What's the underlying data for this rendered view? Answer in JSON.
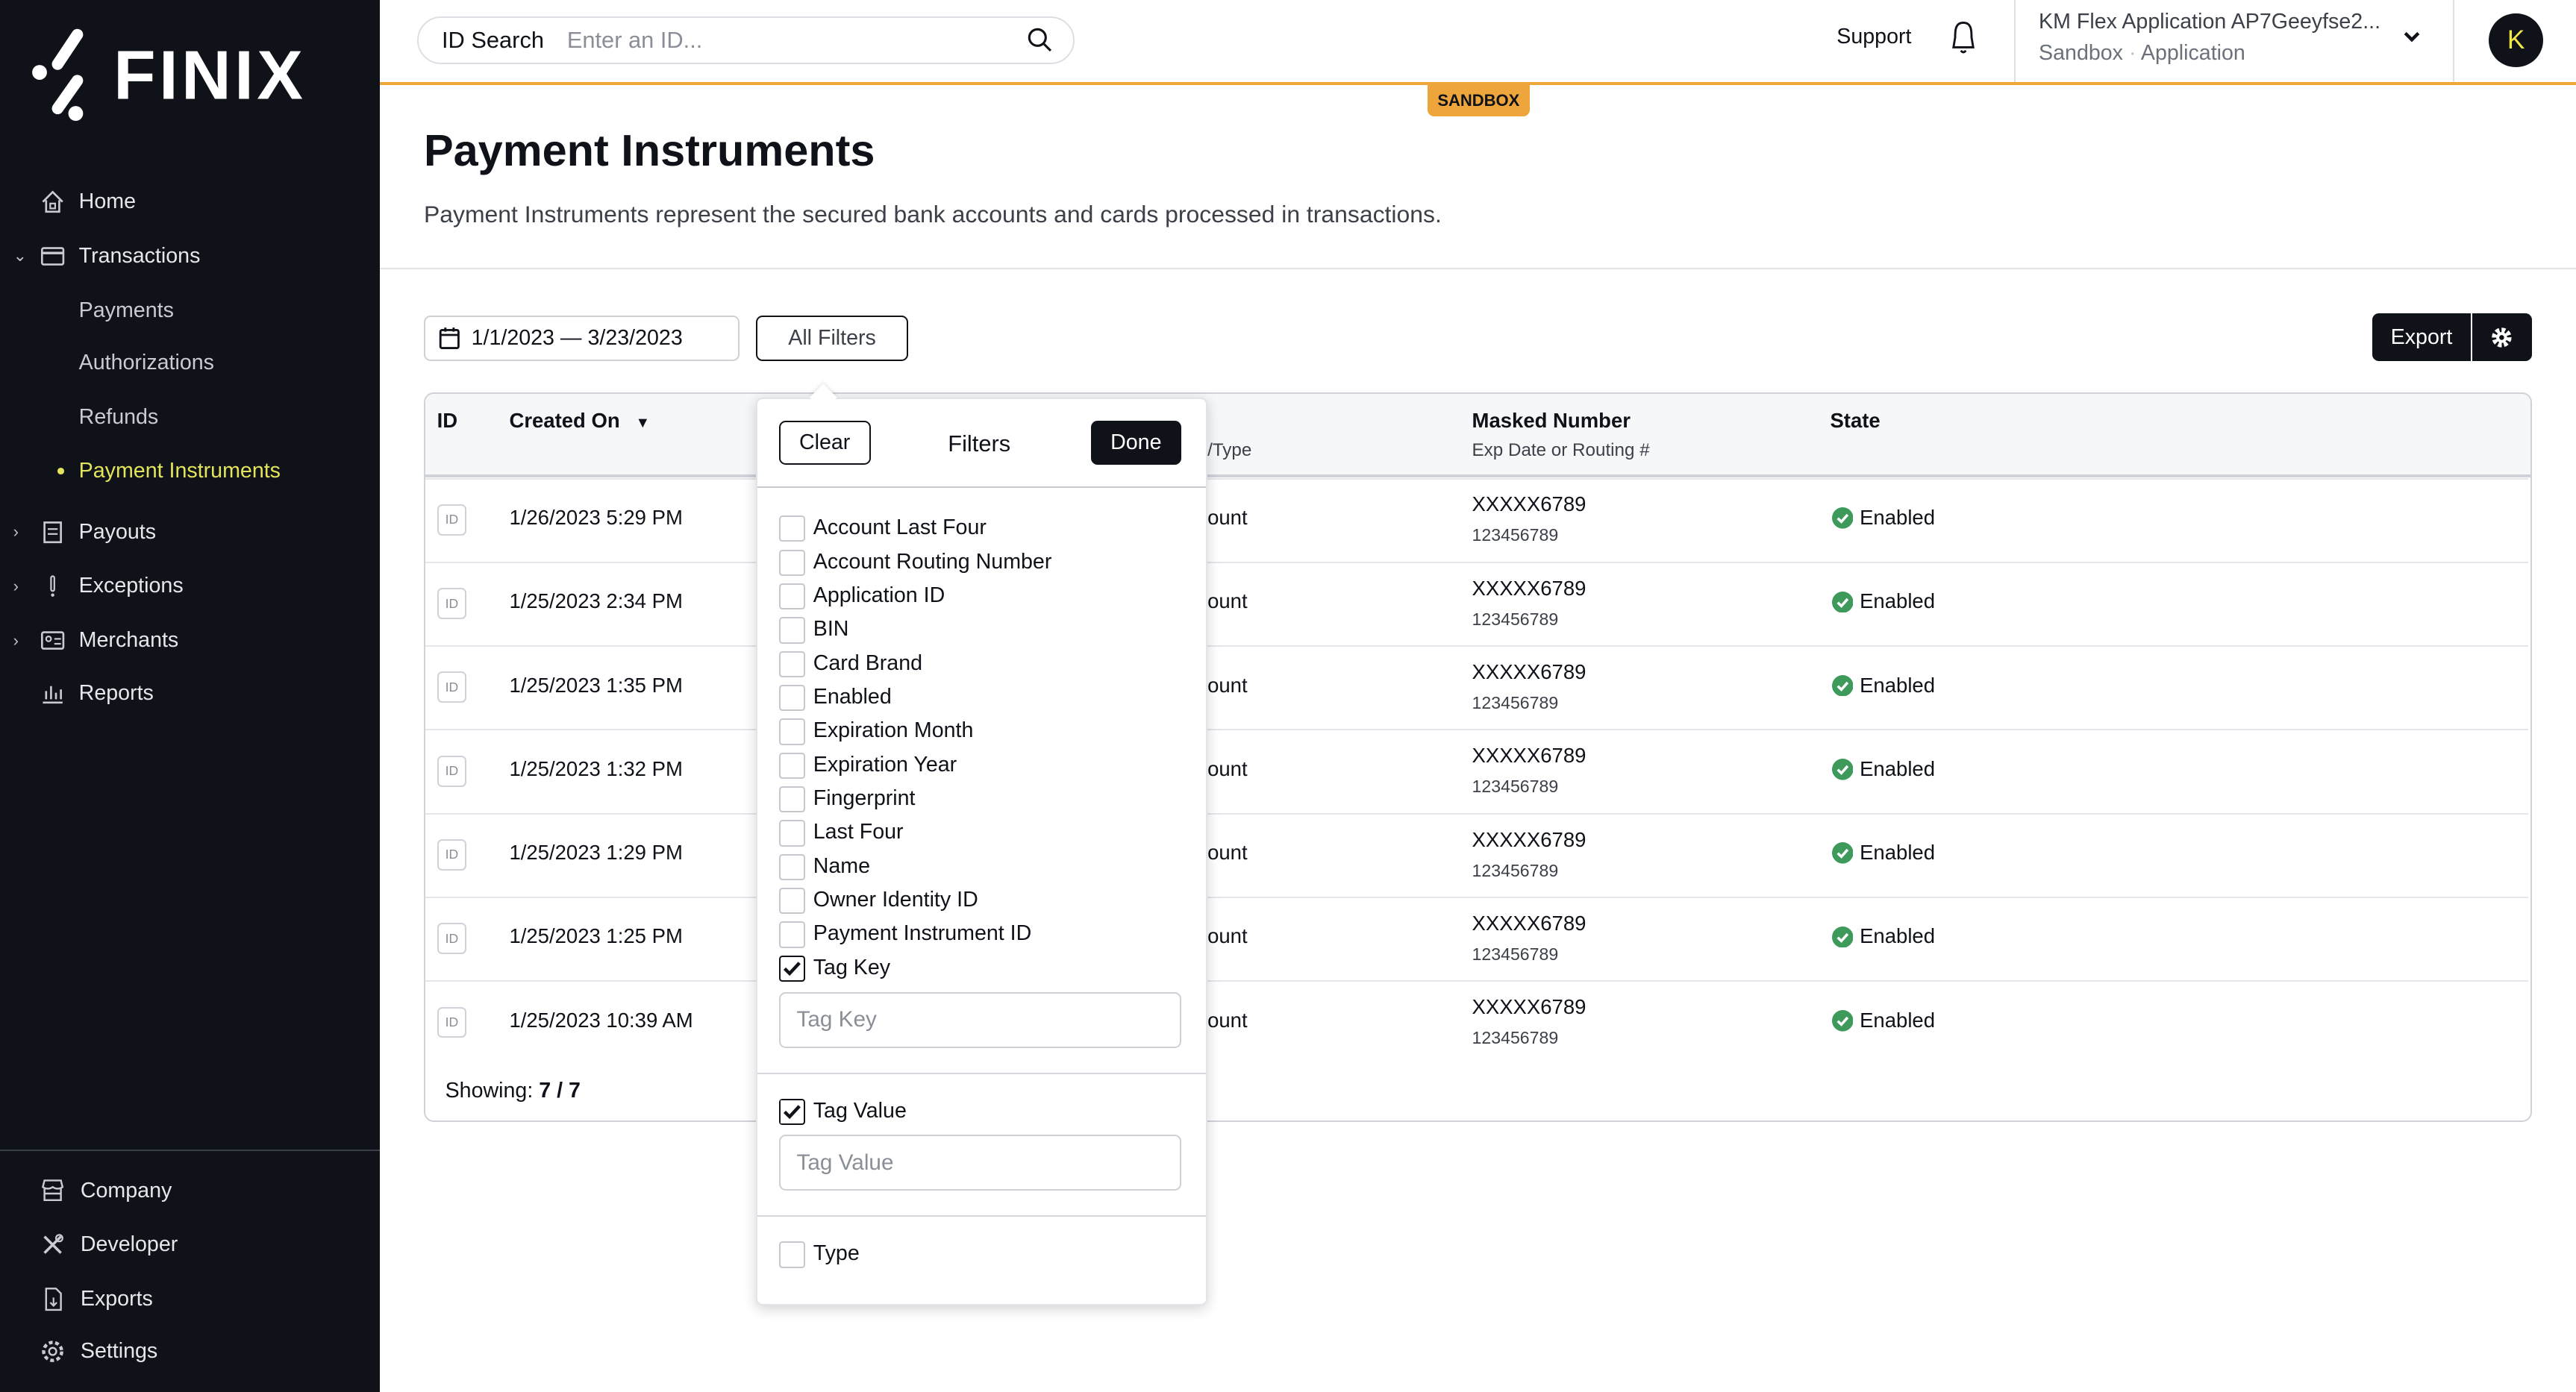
{
  "brand": {
    "logo_text": "FINIX"
  },
  "sidebar": {
    "items": [
      {
        "label": "Home",
        "icon": "home-icon"
      },
      {
        "label": "Transactions",
        "icon": "card-icon",
        "expanded": true
      },
      {
        "label": "Payments"
      },
      {
        "label": "Authorizations"
      },
      {
        "label": "Refunds"
      },
      {
        "label": "Payment Instruments",
        "active": true
      },
      {
        "label": "Payouts",
        "icon": "ledger-icon"
      },
      {
        "label": "Exceptions",
        "icon": "exclamation-icon"
      },
      {
        "label": "Merchants",
        "icon": "id-card-icon"
      },
      {
        "label": "Reports",
        "icon": "bar-chart-icon"
      }
    ],
    "bottom_items": [
      {
        "label": "Company",
        "icon": "store-icon"
      },
      {
        "label": "Developer",
        "icon": "tools-icon"
      },
      {
        "label": "Exports",
        "icon": "file-download-icon"
      },
      {
        "label": "Settings",
        "icon": "gear-icon"
      }
    ]
  },
  "topbar": {
    "search_label": "ID Search",
    "search_placeholder": "Enter an ID...",
    "support": "Support",
    "app_name": "KM Flex Application AP7Geeyfse2...",
    "app_env": "Sandbox",
    "app_type": "Application",
    "avatar": "K",
    "env_badge": "SANDBOX"
  },
  "page": {
    "title": "Payment Instruments",
    "subtitle": "Payment Instruments represent the secured bank accounts and cards processed in transactions."
  },
  "toolbar": {
    "date_range": "1/1/2023 — 3/23/2023",
    "all_filters": "All Filters",
    "export": "Export"
  },
  "table": {
    "headers": {
      "id": "ID",
      "created": "Created On",
      "type": "/Type",
      "masked": "Masked Number",
      "masked_sub": "Exp Date or Routing #",
      "state": "State"
    },
    "rows": [
      {
        "id": "ID",
        "created": "1/26/2023 5:29 PM",
        "type": "ount",
        "masked": "XXXXX6789",
        "routing": "123456789",
        "state": "Enabled"
      },
      {
        "id": "ID",
        "created": "1/25/2023 2:34 PM",
        "type": "ount",
        "masked": "XXXXX6789",
        "routing": "123456789",
        "state": "Enabled"
      },
      {
        "id": "ID",
        "created": "1/25/2023 1:35 PM",
        "type": "ount",
        "masked": "XXXXX6789",
        "routing": "123456789",
        "state": "Enabled"
      },
      {
        "id": "ID",
        "created": "1/25/2023 1:32 PM",
        "type": "ount",
        "masked": "XXXXX6789",
        "routing": "123456789",
        "state": "Enabled"
      },
      {
        "id": "ID",
        "created": "1/25/2023 1:29 PM",
        "type": "ount",
        "masked": "XXXXX6789",
        "routing": "123456789",
        "state": "Enabled"
      },
      {
        "id": "ID",
        "created": "1/25/2023 1:25 PM",
        "type": "ount",
        "masked": "XXXXX6789",
        "routing": "123456789",
        "state": "Enabled"
      },
      {
        "id": "ID",
        "created": "1/25/2023 10:39 AM",
        "type": "ount",
        "masked": "XXXXX6789",
        "routing": "123456789",
        "state": "Enabled"
      }
    ],
    "showing_label": "Showing:",
    "showing_value": "7 / 7"
  },
  "filters": {
    "clear": "Clear",
    "title": "Filters",
    "done": "Done",
    "options": [
      {
        "label": "Account Last Four",
        "checked": false
      },
      {
        "label": "Account Routing Number",
        "checked": false
      },
      {
        "label": "Application ID",
        "checked": false
      },
      {
        "label": "BIN",
        "checked": false
      },
      {
        "label": "Card Brand",
        "checked": false
      },
      {
        "label": "Enabled",
        "checked": false
      },
      {
        "label": "Expiration Month",
        "checked": false
      },
      {
        "label": "Expiration Year",
        "checked": false
      },
      {
        "label": "Fingerprint",
        "checked": false
      },
      {
        "label": "Last Four",
        "checked": false
      },
      {
        "label": "Name",
        "checked": false
      },
      {
        "label": "Owner Identity ID",
        "checked": false
      },
      {
        "label": "Payment Instrument ID",
        "checked": false
      },
      {
        "label": "Tag Key",
        "checked": true
      }
    ],
    "tag_key_placeholder": "Tag Key",
    "tag_value": {
      "label": "Tag Value",
      "checked": true
    },
    "tag_value_placeholder": "Tag Value",
    "type": {
      "label": "Type",
      "checked": false
    }
  },
  "colors": {
    "sidebar_bg": "#0f1219",
    "accent_yellow": "#e4e45a",
    "sandbox_orange": "#eea53b",
    "enabled_green": "#3d9a5b"
  }
}
